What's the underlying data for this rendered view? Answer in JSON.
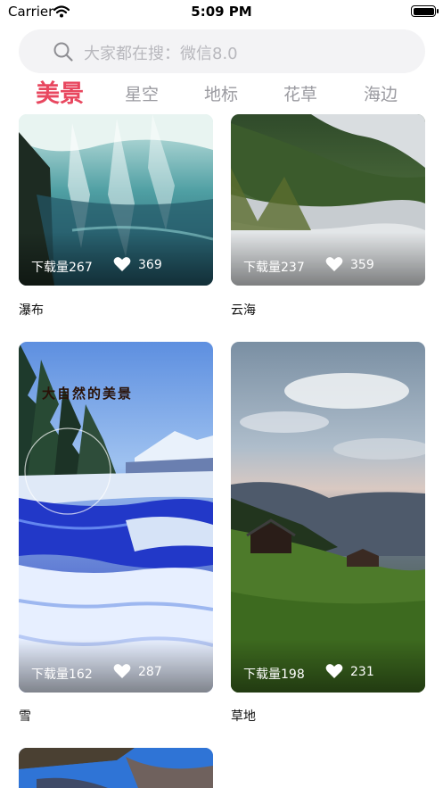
{
  "status_bar": {
    "carrier": "Carrier",
    "time": "5:09 PM",
    "icons": [
      "wifi-icon",
      "battery-icon"
    ]
  },
  "search": {
    "placeholder": "大家都在搜：微信8.0",
    "icon": "search-icon"
  },
  "tabs": [
    {
      "label": "美景",
      "active": true
    },
    {
      "label": "星空",
      "active": false
    },
    {
      "label": "地标",
      "active": false
    },
    {
      "label": "花草",
      "active": false
    },
    {
      "label": "海边",
      "active": false
    }
  ],
  "accent_color": "#e8475f",
  "wallpapers": [
    {
      "title": "瀑布",
      "downloads": "下载量267",
      "likes": "369"
    },
    {
      "title": "云海",
      "downloads": "下载量237",
      "likes": "359"
    },
    {
      "title": "雪",
      "downloads": "下载量162",
      "likes": "287",
      "image_text": "大自然的美景"
    },
    {
      "title": "草地",
      "downloads": "下载量198",
      "likes": "231"
    }
  ]
}
